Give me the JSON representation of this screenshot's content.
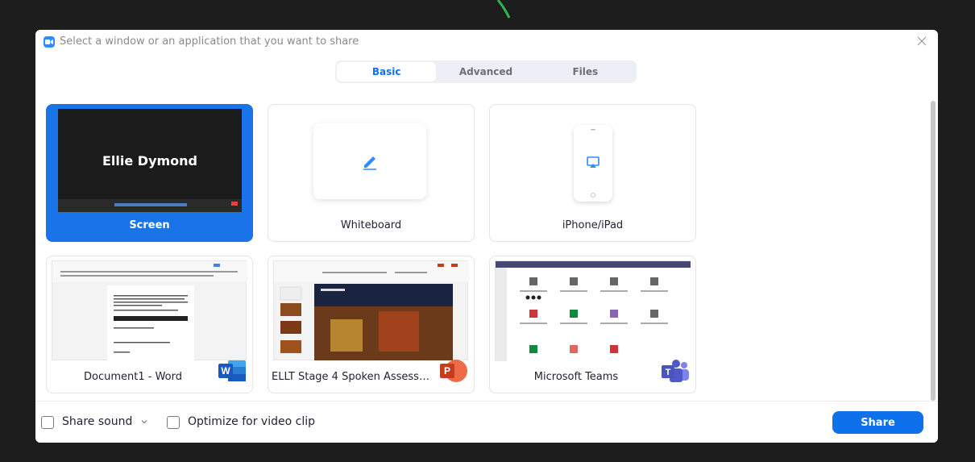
{
  "window": {
    "title": "Select a window or an application that you want to share"
  },
  "tabs": [
    {
      "label": "Basic",
      "active": true
    },
    {
      "label": "Advanced",
      "active": false
    },
    {
      "label": "Files",
      "active": false
    }
  ],
  "cards": {
    "screen": {
      "label": "Screen",
      "preview_name": "Ellie Dymond",
      "selected": true
    },
    "whiteboard": {
      "label": "Whiteboard"
    },
    "iphone": {
      "label": "iPhone/iPad"
    },
    "word": {
      "label": "Document1 - Word",
      "badge_letter": "W"
    },
    "powerpoint": {
      "label": "ELLT Stage 4 Spoken Assessment ...",
      "badge_letter": "P"
    },
    "teams": {
      "label": "Microsoft Teams",
      "badge_letter": "T"
    }
  },
  "bottom": {
    "share_sound_label": "Share sound",
    "optimize_label": "Optimize for video clip",
    "share_button_label": "Share"
  },
  "colors": {
    "accent": "#0e71eb",
    "selected_card": "#1a73e8",
    "word_blue": "#185abd",
    "ppt_orange": "#c43e1c",
    "teams_purple": "#5059c9"
  },
  "icons": {
    "app": "zoom-camera-icon",
    "close": "close-icon",
    "whiteboard": "pen-icon",
    "iphone": "airplay-icon",
    "chevron": "chevron-down-icon"
  }
}
